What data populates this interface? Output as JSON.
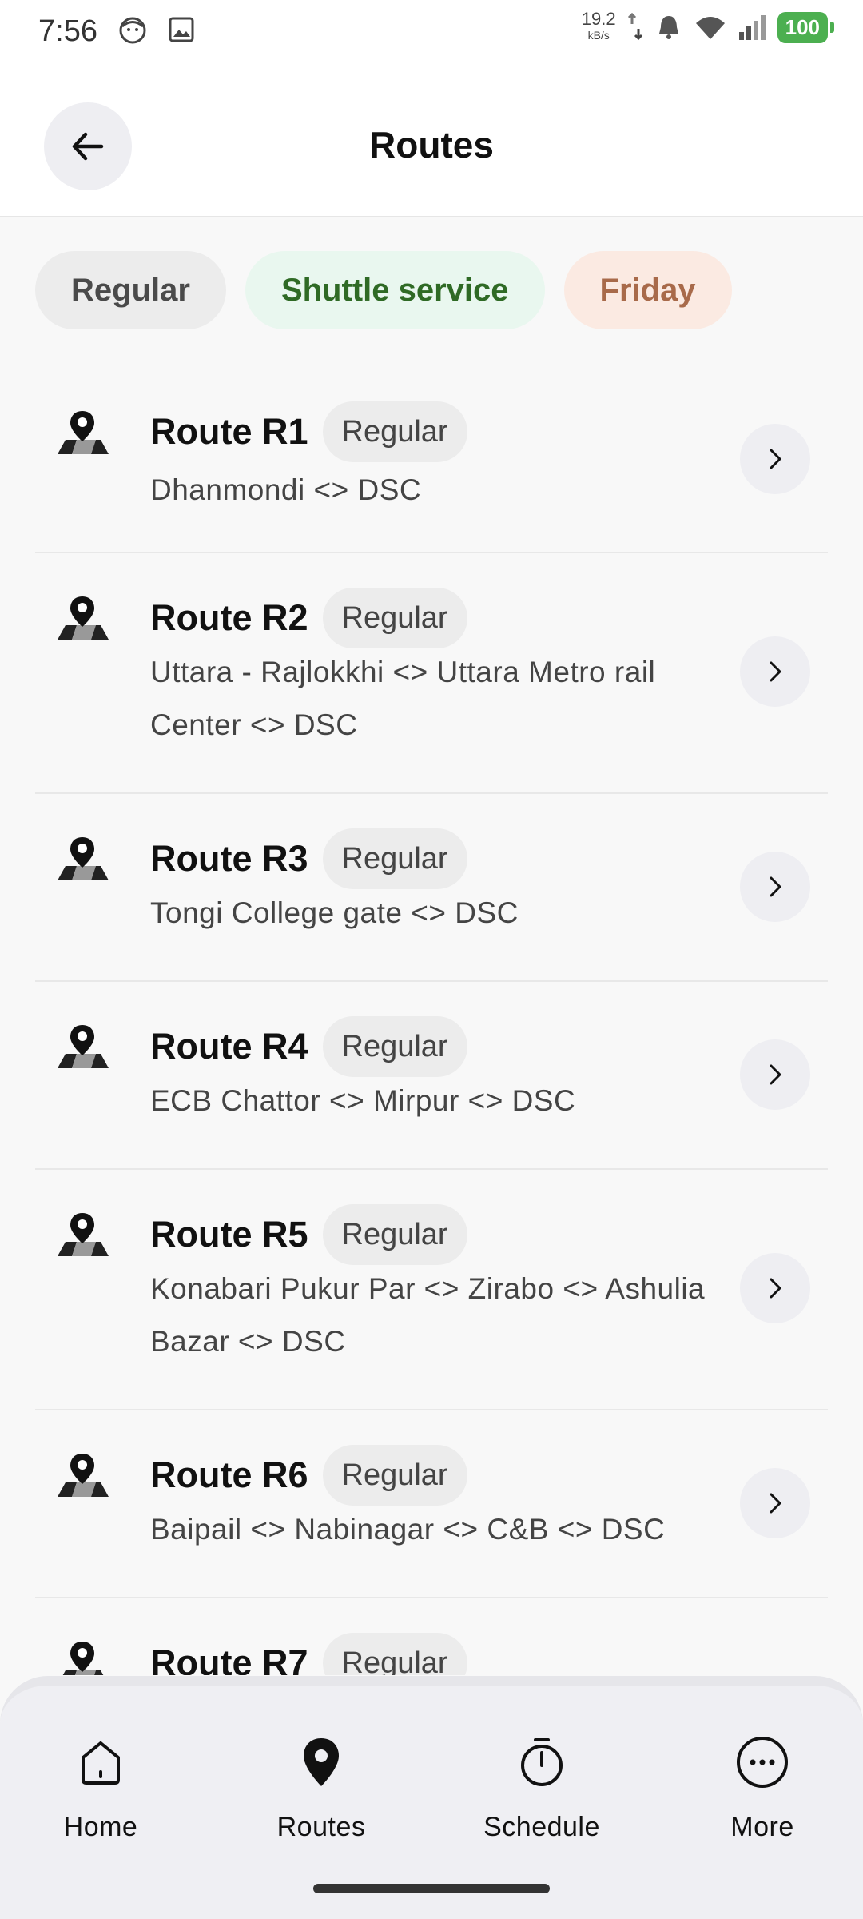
{
  "status_bar": {
    "time": "7:56",
    "net_speed": "19.2",
    "net_unit": "kB/s",
    "battery": "100"
  },
  "header": {
    "title": "Routes"
  },
  "filters": [
    {
      "label": "Regular",
      "color": "#ececec"
    },
    {
      "label": "Shuttle service",
      "color": "#e9f7ef"
    },
    {
      "label": "Friday",
      "color": "#fbeae2"
    }
  ],
  "routes": [
    {
      "name": "Route R1",
      "type": "Regular",
      "description": "Dhanmondi <> DSC"
    },
    {
      "name": "Route R2",
      "type": "Regular",
      "description": "Uttara - Rajlokkhi <> Uttara Metro rail Center <> DSC"
    },
    {
      "name": "Route R3",
      "type": "Regular",
      "description": "Tongi College gate <> DSC"
    },
    {
      "name": "Route R4",
      "type": "Regular",
      "description": "ECB Chattor <> Mirpur <> DSC"
    },
    {
      "name": "Route R5",
      "type": "Regular",
      "description": "Konabari Pukur Par <> Zirabo <> Ashulia Bazar <> DSC"
    },
    {
      "name": "Route R6",
      "type": "Regular",
      "description": "Baipail <> Nabinagar <> C&B <> DSC"
    },
    {
      "name": "Route R7",
      "type": "Regular",
      "description": ""
    }
  ],
  "bottom_nav": [
    {
      "label": "Home",
      "icon": "home-icon",
      "active": false
    },
    {
      "label": "Routes",
      "icon": "map-pin-icon",
      "active": true
    },
    {
      "label": "Schedule",
      "icon": "stopwatch-icon",
      "active": false
    },
    {
      "label": "More",
      "icon": "more-icon",
      "active": false
    }
  ]
}
